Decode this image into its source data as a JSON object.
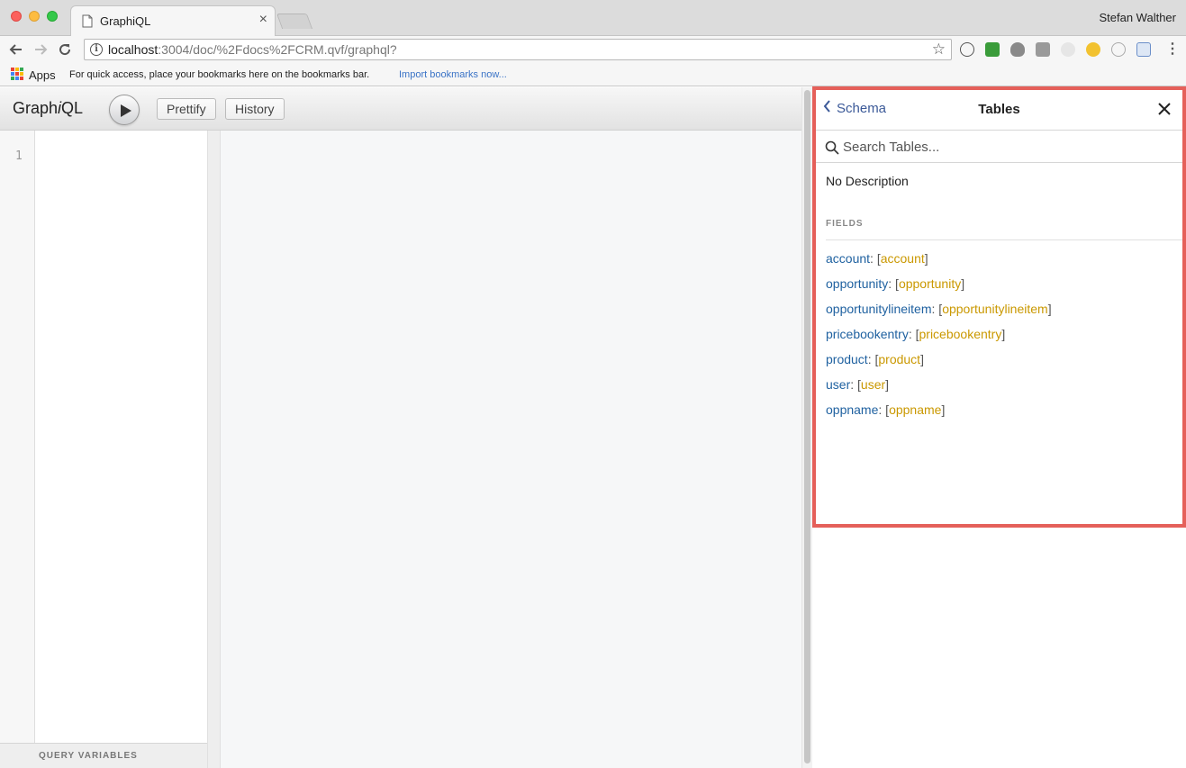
{
  "browser": {
    "tab_title": "GraphiQL",
    "tab_close": "×",
    "profile_name": "Stefan Walther",
    "url_host": "localhost",
    "url_rest": ":3004/doc/%2Fdocs%2FCRM.qvf/graphql?",
    "bookmarks": {
      "apps_label": "Apps",
      "hint": "For quick access, place your bookmarks here on the bookmarks bar.",
      "import_link": "Import bookmarks now..."
    }
  },
  "graphiql": {
    "logo_prefix": "Graph",
    "logo_i": "i",
    "logo_suffix": "QL",
    "prettify_label": "Prettify",
    "history_label": "History",
    "line_number": "1",
    "query_variables_label": "QUERY VARIABLES"
  },
  "doc_explorer": {
    "back_label": "Schema",
    "title": "Tables",
    "search_placeholder": "Search Tables...",
    "description": "No Description",
    "fields_heading": "FIELDS",
    "fields": [
      {
        "name": "account",
        "type": "account"
      },
      {
        "name": "opportunity",
        "type": "opportunity"
      },
      {
        "name": "opportunitylineitem",
        "type": "opportunitylineitem"
      },
      {
        "name": "pricebookentry",
        "type": "pricebookentry"
      },
      {
        "name": "product",
        "type": "product"
      },
      {
        "name": "user",
        "type": "user"
      },
      {
        "name": "oppname",
        "type": "oppname"
      }
    ]
  },
  "colors": {
    "highlight_border": "#e5605a",
    "field_name": "#1f61a0",
    "field_type": "#ca9800",
    "link": "#3b5998"
  }
}
